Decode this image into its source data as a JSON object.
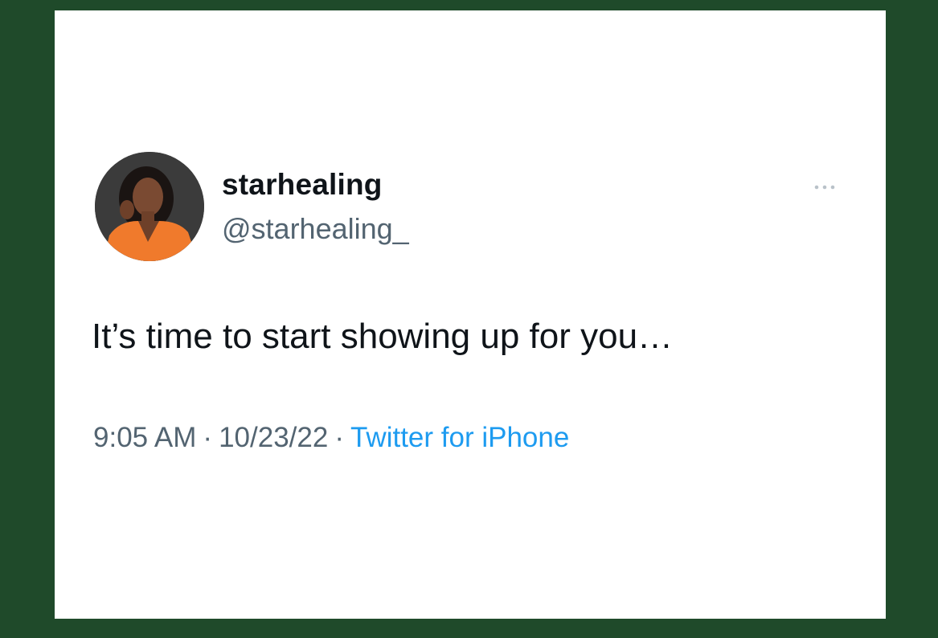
{
  "tweet": {
    "display_name": "starhealing",
    "handle": "@starhealing_",
    "text": "It’s time to start showing up for you…",
    "time": "9:05 AM",
    "date": "10/23/22",
    "source": "Twitter for iPhone",
    "separator": "·"
  },
  "icons": {
    "more": "more-options-icon",
    "avatar": "profile-avatar"
  },
  "colors": {
    "background": "#1f4a2a",
    "card": "#ffffff",
    "text_primary": "#0f1419",
    "text_secondary": "#536471",
    "link": "#1d9bf0"
  }
}
